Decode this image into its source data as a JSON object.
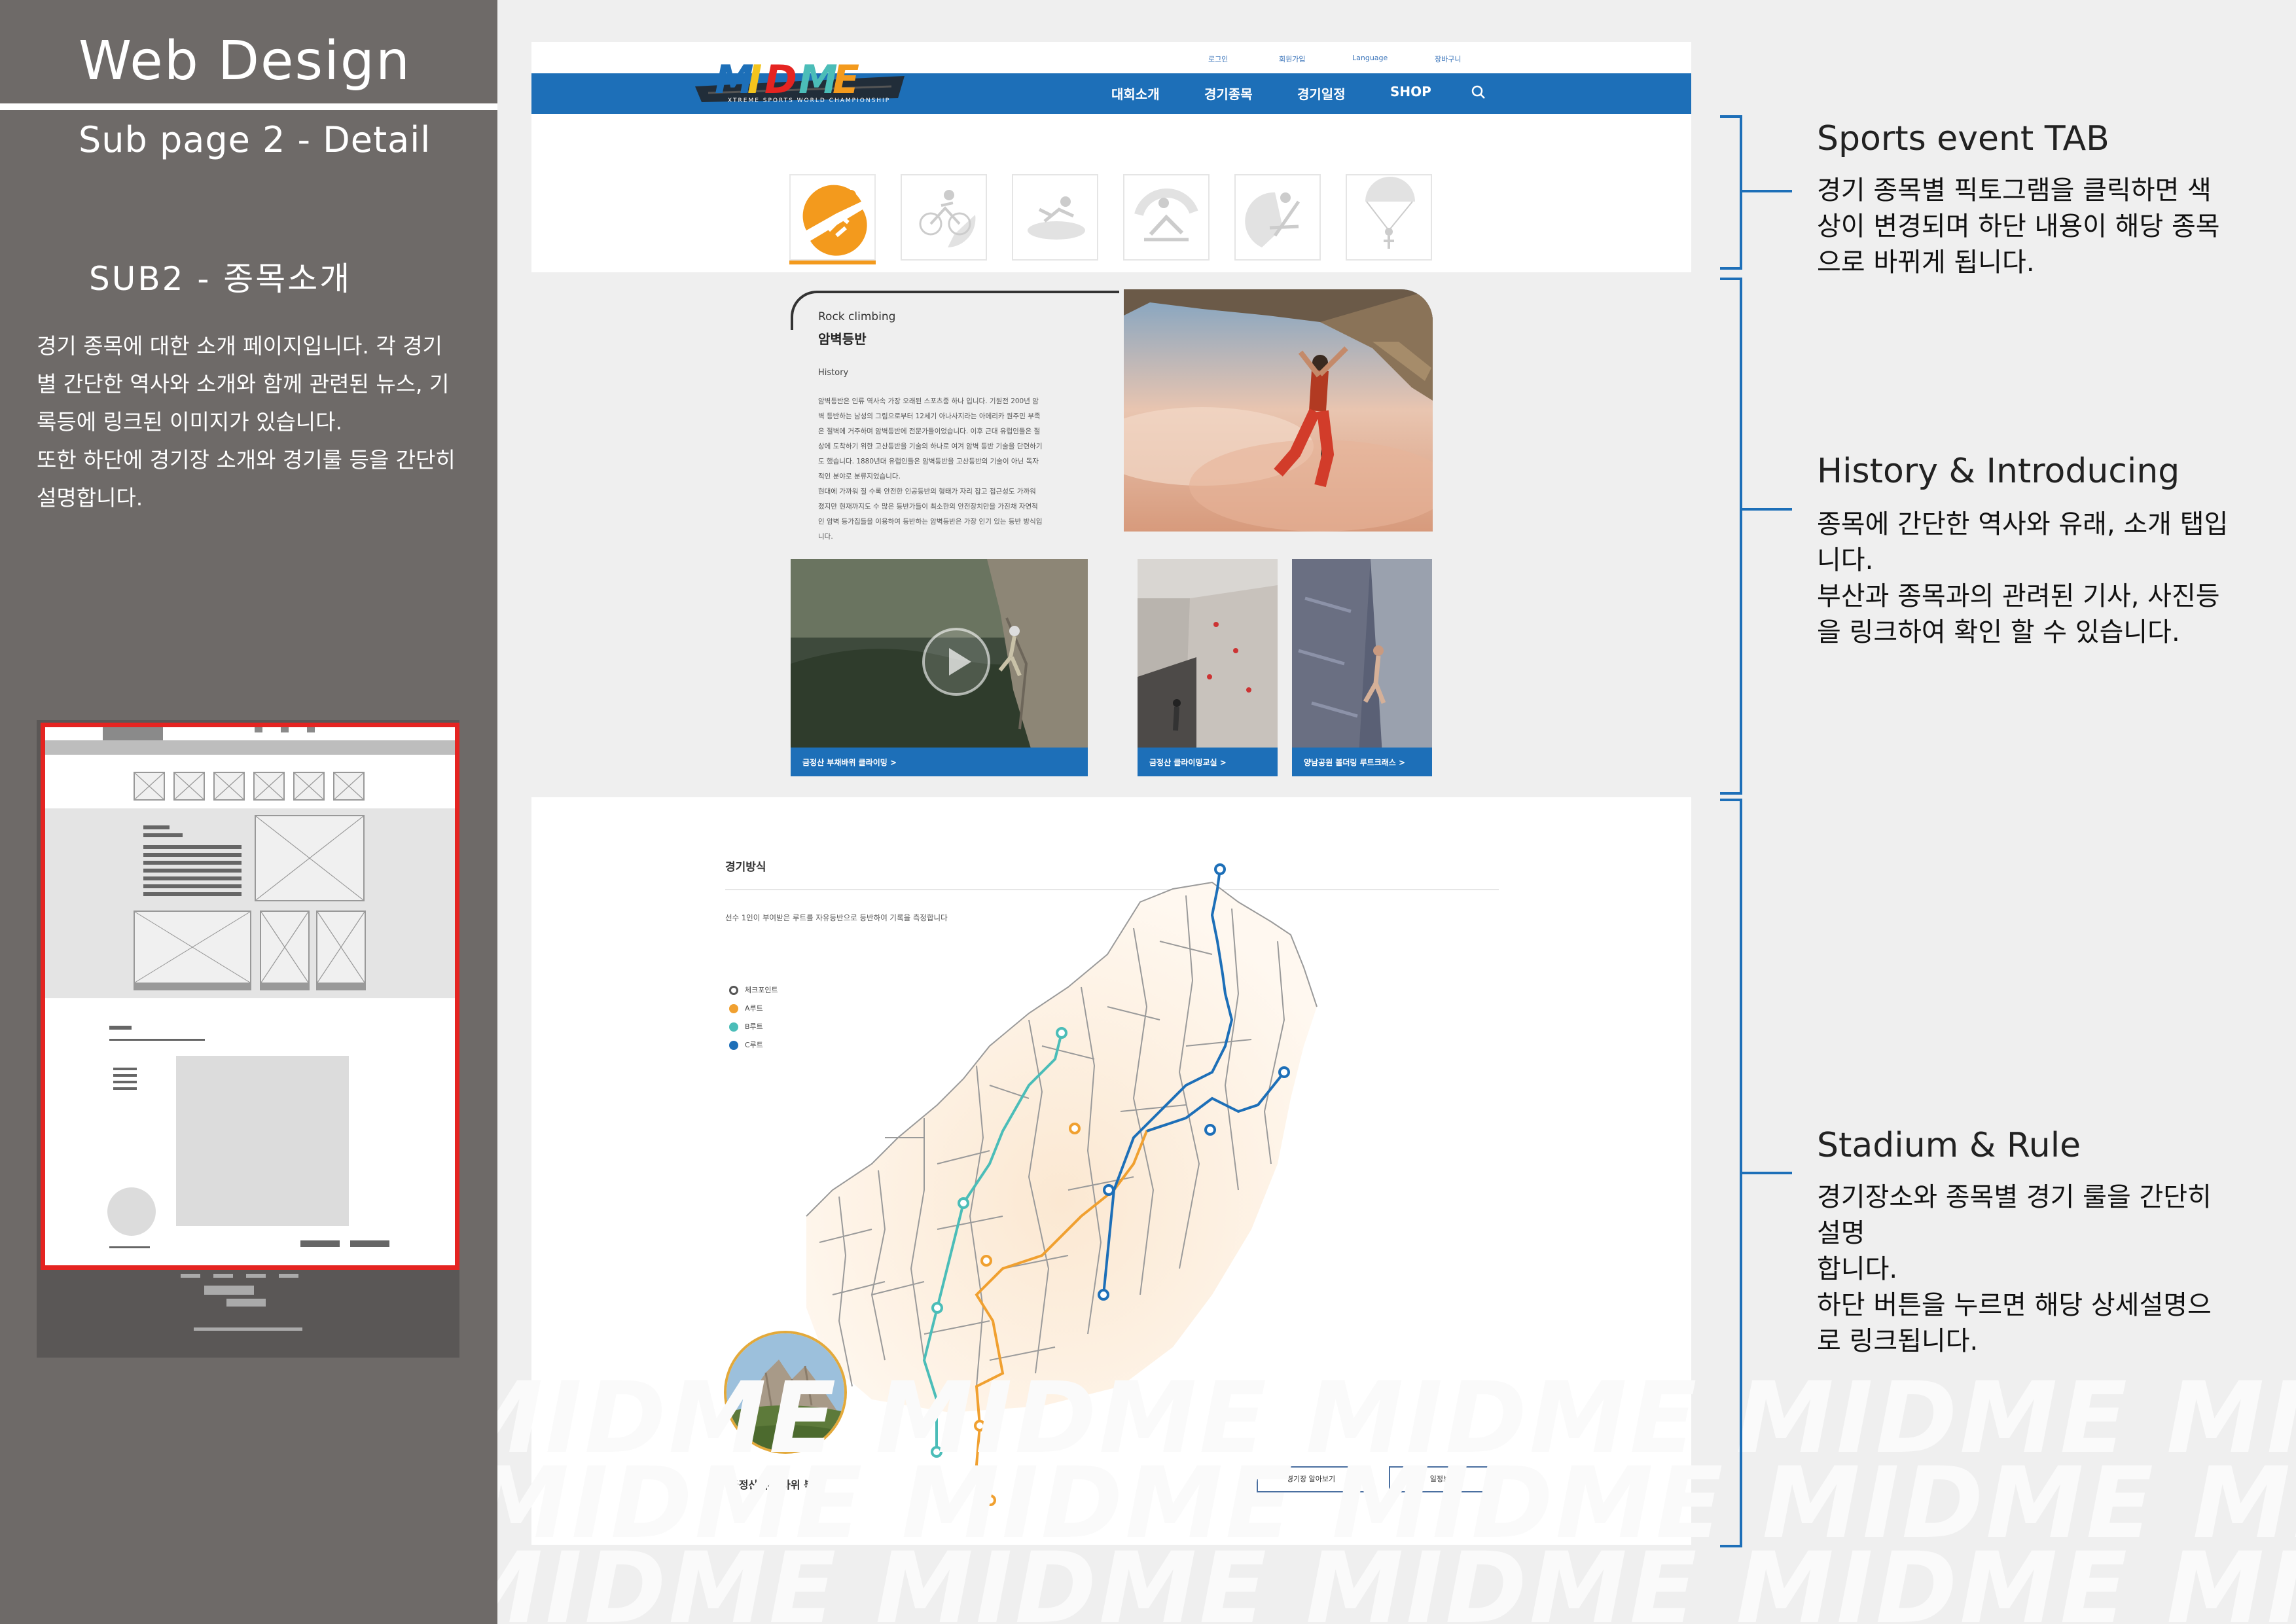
{
  "panel": {
    "title": "Web Design",
    "subtitle": "Sub page 2 - Detail",
    "section": "SUB2 - 종목소개",
    "description": [
      "경기 종목에 대한 소개 페이지입니다. 각 경기",
      "별 간단한 역사와 소개와 함께 관련된 뉴스, 기",
      "록등에 링크된 이미지가 있습니다.",
      "또한 하단에 경기장 소개와 경기룰 등을 간단히",
      "설명합니다."
    ]
  },
  "header": {
    "logo_text": "MIDME",
    "logo_tagline": "XTREME SPORTS WORLD CHAMPIONSHIP",
    "top_links": [
      "로그인",
      "회원가입",
      "Language",
      "장바구니"
    ],
    "nav": [
      "대회소개",
      "경기종목",
      "경기일정",
      "SHOP"
    ]
  },
  "sport_tabs": [
    "rock-climbing",
    "bmx",
    "surfing",
    "skateboard",
    "kayak",
    "skydiving"
  ],
  "intro": {
    "en_name": "Rock climbing",
    "ko_name": "암벽등반",
    "history_label": "History",
    "history_text": [
      "암벽등반은 인류 역사속 가장 오래된 스포츠중 하나 입니다. 기원전 200년 암",
      "벽 등반하는 남성의 그림으로부터 12세기 아나사지라는 아메리카 원주민 부족",
      "은 절벽에 거주하며 암벽등반에 전문가들이었습니다. 이후 근대 유럽인들은 절",
      "상에 도착하기 위한 고산등반을 기술의 하나로 여겨 암벽 등반 기술을 단련하기",
      "도 했습니다. 1880년대 유럽인들은 암벽등반을 고산등반의 기술이 아닌 독자",
      "적인 분야로 분류지었습니다.",
      "현대에 가까워 질 수록 안전한 인공등반의 형태가 자리 잡고 접근성도 가까워",
      "졌지만 현재까지도 수 많은 등반가들이 최소한의 안전장치만을 가진채 자연적",
      "인 암벽 등가집들을 이용하여 등반하는 암벽등반은 가장 인기 있는 등반 방식입",
      "니다."
    ]
  },
  "media": [
    {
      "caption": "금정산 부채바위 클라이밍 >",
      "type": "video"
    },
    {
      "caption": "금정산 클라이밍교실 >",
      "type": "photo"
    },
    {
      "caption": "양남공원 볼더링 루트크래스 >",
      "type": "photo"
    }
  ],
  "stadium": {
    "heading": "경기방식",
    "note": "선수 1인이 부여받은 루트를 자유등반으로 등반하여 기록을 측정합니다",
    "legend": [
      {
        "label": "체크포인트",
        "color": "#ffffff"
      },
      {
        "label": "A루트",
        "color": "#f0a030"
      },
      {
        "label": "B루트",
        "color": "#4bbdb8"
      },
      {
        "label": "C루트",
        "color": "#1d6fb8"
      }
    ],
    "location": "금정산 부채바위 북벽",
    "buttons": [
      "경기장 알아보기",
      "일정보기"
    ]
  },
  "annotations": [
    {
      "title": "Sports event TAB",
      "lines": [
        "경기 종목별 픽토그램을 클릭하면 색",
        "상이 변경되며 하단 내용이 해당 종목",
        "으로 바뀌게 됩니다."
      ]
    },
    {
      "title": "History & Introducing",
      "lines": [
        "종목에 간단한 역사와 유래, 소개 탭입",
        "니다.",
        "부산과 종목과의 관려된 기사, 사진등",
        "을 링크하여 확인 할 수 있습니다."
      ]
    },
    {
      "title": "Stadium & Rule",
      "lines": [
        "경기장소와 종목별 경기 룰을 간단히",
        "설명",
        "합니다.",
        "하단 버튼을 누르면 해당 상세설명으",
        "로 링크됩니다."
      ]
    }
  ],
  "watermark": "MIDME MIDME MIDME MIDME MIDME MIDME MIDME",
  "colors": {
    "panel": "#6e6a68",
    "brand_blue": "#1d6fb8",
    "accent_orange": "#f39a1d",
    "route_b": "#4bbdb8",
    "highlight_red": "#e52421"
  }
}
